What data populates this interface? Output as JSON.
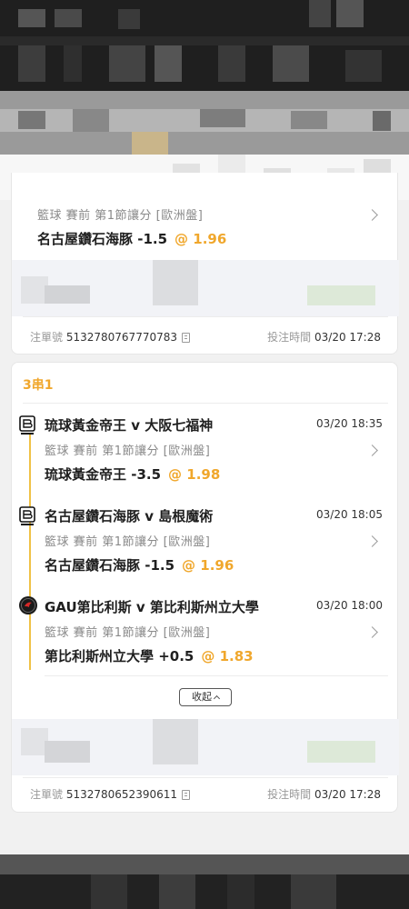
{
  "card1": {
    "meta": "籃球  賽前  第1節讓分 [歐洲盤]",
    "pick": "名古屋鑽石海豚 -1.5",
    "odds": "@ 1.96",
    "order_label": "注單號",
    "order_no": "5132780767770783",
    "time_label": "投注時間",
    "time": "03/20 17:28"
  },
  "card2": {
    "title": "3串1",
    "legs": [
      {
        "title": "琉球黃金帝王 v 大阪七福神",
        "time": "03/20 18:35",
        "meta": "籃球  賽前  第1節讓分 [歐洲盤]",
        "pick": "琉球黃金帝王 -3.5",
        "odds": "@ 1.98",
        "logo": "b-league-logo"
      },
      {
        "title": "名古屋鑽石海豚 v 島根魔術",
        "time": "03/20 18:05",
        "meta": "籃球  賽前  第1節讓分 [歐洲盤]",
        "pick": "名古屋鑽石海豚 -1.5",
        "odds": "@ 1.96",
        "logo": "b-league-logo"
      },
      {
        "title": "GAU第比利斯 v 第比利斯州立大學",
        "time": "03/20 18:00",
        "meta": "籃球  賽前  第1節讓分 [歐洲盤]",
        "pick": "第比利斯州立大學 +0.5",
        "odds": "@ 1.83",
        "logo": "team-badge"
      }
    ],
    "collapse_label": "收起",
    "order_label": "注單號",
    "order_no": "5132780652390611",
    "time_label": "投注時間",
    "time": "03/20 17:28"
  },
  "colors": {
    "accent": "#f0a72c",
    "line": "#f0c145"
  }
}
